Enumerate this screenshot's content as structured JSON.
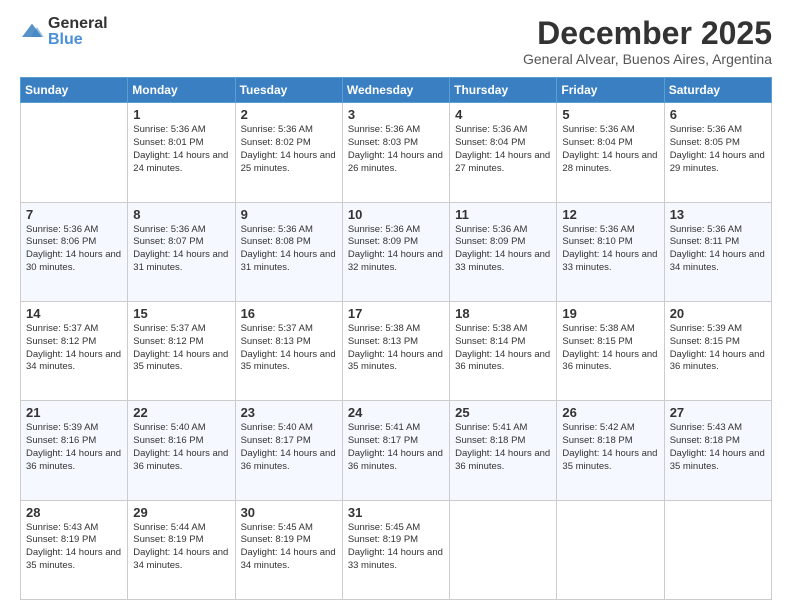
{
  "logo": {
    "general": "General",
    "blue": "Blue"
  },
  "header": {
    "month": "December 2025",
    "location": "General Alvear, Buenos Aires, Argentina"
  },
  "days": [
    "Sunday",
    "Monday",
    "Tuesday",
    "Wednesday",
    "Thursday",
    "Friday",
    "Saturday"
  ],
  "weeks": [
    [
      {
        "day": "",
        "sunrise": "",
        "sunset": "",
        "daylight": ""
      },
      {
        "day": "1",
        "sunrise": "Sunrise: 5:36 AM",
        "sunset": "Sunset: 8:01 PM",
        "daylight": "Daylight: 14 hours and 24 minutes."
      },
      {
        "day": "2",
        "sunrise": "Sunrise: 5:36 AM",
        "sunset": "Sunset: 8:02 PM",
        "daylight": "Daylight: 14 hours and 25 minutes."
      },
      {
        "day": "3",
        "sunrise": "Sunrise: 5:36 AM",
        "sunset": "Sunset: 8:03 PM",
        "daylight": "Daylight: 14 hours and 26 minutes."
      },
      {
        "day": "4",
        "sunrise": "Sunrise: 5:36 AM",
        "sunset": "Sunset: 8:04 PM",
        "daylight": "Daylight: 14 hours and 27 minutes."
      },
      {
        "day": "5",
        "sunrise": "Sunrise: 5:36 AM",
        "sunset": "Sunset: 8:04 PM",
        "daylight": "Daylight: 14 hours and 28 minutes."
      },
      {
        "day": "6",
        "sunrise": "Sunrise: 5:36 AM",
        "sunset": "Sunset: 8:05 PM",
        "daylight": "Daylight: 14 hours and 29 minutes."
      }
    ],
    [
      {
        "day": "7",
        "sunrise": "Sunrise: 5:36 AM",
        "sunset": "Sunset: 8:06 PM",
        "daylight": "Daylight: 14 hours and 30 minutes."
      },
      {
        "day": "8",
        "sunrise": "Sunrise: 5:36 AM",
        "sunset": "Sunset: 8:07 PM",
        "daylight": "Daylight: 14 hours and 31 minutes."
      },
      {
        "day": "9",
        "sunrise": "Sunrise: 5:36 AM",
        "sunset": "Sunset: 8:08 PM",
        "daylight": "Daylight: 14 hours and 31 minutes."
      },
      {
        "day": "10",
        "sunrise": "Sunrise: 5:36 AM",
        "sunset": "Sunset: 8:09 PM",
        "daylight": "Daylight: 14 hours and 32 minutes."
      },
      {
        "day": "11",
        "sunrise": "Sunrise: 5:36 AM",
        "sunset": "Sunset: 8:09 PM",
        "daylight": "Daylight: 14 hours and 33 minutes."
      },
      {
        "day": "12",
        "sunrise": "Sunrise: 5:36 AM",
        "sunset": "Sunset: 8:10 PM",
        "daylight": "Daylight: 14 hours and 33 minutes."
      },
      {
        "day": "13",
        "sunrise": "Sunrise: 5:36 AM",
        "sunset": "Sunset: 8:11 PM",
        "daylight": "Daylight: 14 hours and 34 minutes."
      }
    ],
    [
      {
        "day": "14",
        "sunrise": "Sunrise: 5:37 AM",
        "sunset": "Sunset: 8:12 PM",
        "daylight": "Daylight: 14 hours and 34 minutes."
      },
      {
        "day": "15",
        "sunrise": "Sunrise: 5:37 AM",
        "sunset": "Sunset: 8:12 PM",
        "daylight": "Daylight: 14 hours and 35 minutes."
      },
      {
        "day": "16",
        "sunrise": "Sunrise: 5:37 AM",
        "sunset": "Sunset: 8:13 PM",
        "daylight": "Daylight: 14 hours and 35 minutes."
      },
      {
        "day": "17",
        "sunrise": "Sunrise: 5:38 AM",
        "sunset": "Sunset: 8:13 PM",
        "daylight": "Daylight: 14 hours and 35 minutes."
      },
      {
        "day": "18",
        "sunrise": "Sunrise: 5:38 AM",
        "sunset": "Sunset: 8:14 PM",
        "daylight": "Daylight: 14 hours and 36 minutes."
      },
      {
        "day": "19",
        "sunrise": "Sunrise: 5:38 AM",
        "sunset": "Sunset: 8:15 PM",
        "daylight": "Daylight: 14 hours and 36 minutes."
      },
      {
        "day": "20",
        "sunrise": "Sunrise: 5:39 AM",
        "sunset": "Sunset: 8:15 PM",
        "daylight": "Daylight: 14 hours and 36 minutes."
      }
    ],
    [
      {
        "day": "21",
        "sunrise": "Sunrise: 5:39 AM",
        "sunset": "Sunset: 8:16 PM",
        "daylight": "Daylight: 14 hours and 36 minutes."
      },
      {
        "day": "22",
        "sunrise": "Sunrise: 5:40 AM",
        "sunset": "Sunset: 8:16 PM",
        "daylight": "Daylight: 14 hours and 36 minutes."
      },
      {
        "day": "23",
        "sunrise": "Sunrise: 5:40 AM",
        "sunset": "Sunset: 8:17 PM",
        "daylight": "Daylight: 14 hours and 36 minutes."
      },
      {
        "day": "24",
        "sunrise": "Sunrise: 5:41 AM",
        "sunset": "Sunset: 8:17 PM",
        "daylight": "Daylight: 14 hours and 36 minutes."
      },
      {
        "day": "25",
        "sunrise": "Sunrise: 5:41 AM",
        "sunset": "Sunset: 8:18 PM",
        "daylight": "Daylight: 14 hours and 36 minutes."
      },
      {
        "day": "26",
        "sunrise": "Sunrise: 5:42 AM",
        "sunset": "Sunset: 8:18 PM",
        "daylight": "Daylight: 14 hours and 35 minutes."
      },
      {
        "day": "27",
        "sunrise": "Sunrise: 5:43 AM",
        "sunset": "Sunset: 8:18 PM",
        "daylight": "Daylight: 14 hours and 35 minutes."
      }
    ],
    [
      {
        "day": "28",
        "sunrise": "Sunrise: 5:43 AM",
        "sunset": "Sunset: 8:19 PM",
        "daylight": "Daylight: 14 hours and 35 minutes."
      },
      {
        "day": "29",
        "sunrise": "Sunrise: 5:44 AM",
        "sunset": "Sunset: 8:19 PM",
        "daylight": "Daylight: 14 hours and 34 minutes."
      },
      {
        "day": "30",
        "sunrise": "Sunrise: 5:45 AM",
        "sunset": "Sunset: 8:19 PM",
        "daylight": "Daylight: 14 hours and 34 minutes."
      },
      {
        "day": "31",
        "sunrise": "Sunrise: 5:45 AM",
        "sunset": "Sunset: 8:19 PM",
        "daylight": "Daylight: 14 hours and 33 minutes."
      },
      {
        "day": "",
        "sunrise": "",
        "sunset": "",
        "daylight": ""
      },
      {
        "day": "",
        "sunrise": "",
        "sunset": "",
        "daylight": ""
      },
      {
        "day": "",
        "sunrise": "",
        "sunset": "",
        "daylight": ""
      }
    ]
  ]
}
